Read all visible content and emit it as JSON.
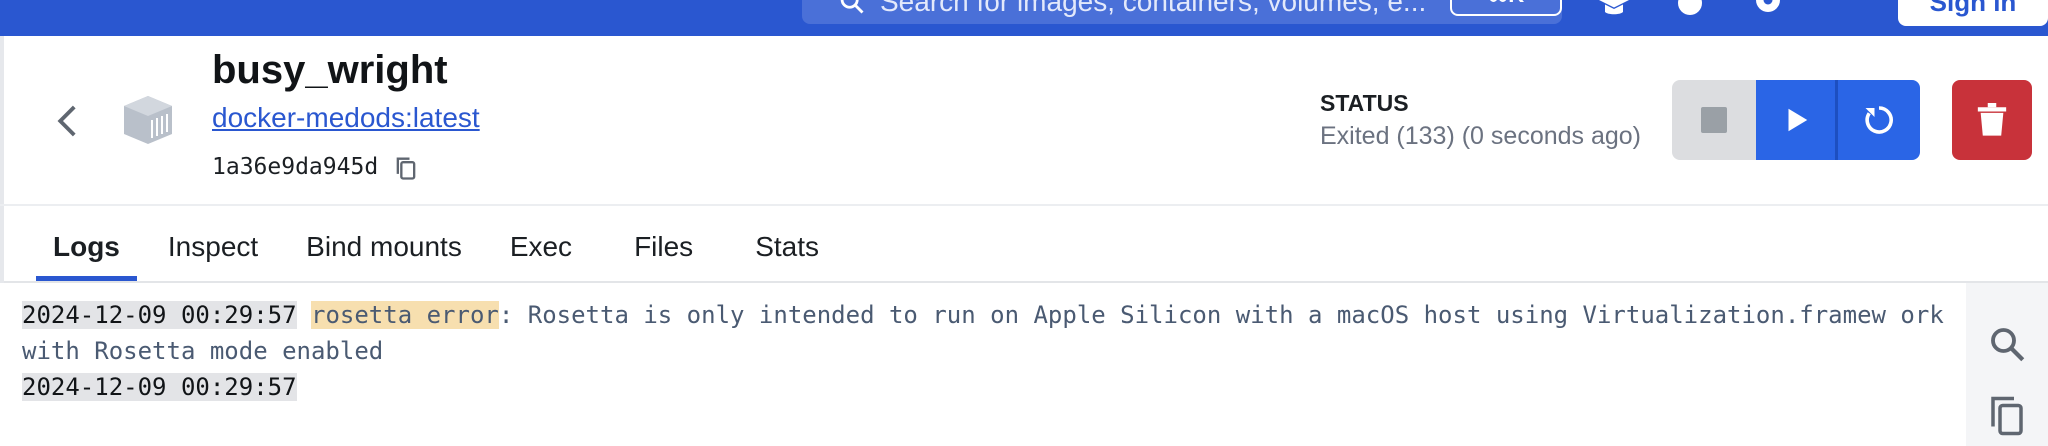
{
  "topbar": {
    "search_placeholder": "Search for images, containers, volumes, e...",
    "search_shortcut": "⌘K",
    "signin_label": "Sign in",
    "icons": [
      "learning-center-icon",
      "extensions-icon",
      "settings-icon",
      "apps-grid-icon"
    ]
  },
  "container": {
    "name": "busy_wright",
    "image": "docker-medods:latest",
    "id": "1a36e9da945d",
    "status_label": "STATUS",
    "status_text": "Exited (133) (0 seconds ago)"
  },
  "tabs": [
    {
      "label": "Logs",
      "active": true
    },
    {
      "label": "Inspect",
      "active": false
    },
    {
      "label": "Bind mounts",
      "active": false
    },
    {
      "label": "Exec",
      "active": false
    },
    {
      "label": "Files",
      "active": false
    },
    {
      "label": "Stats",
      "active": false
    }
  ],
  "logs": {
    "lines": [
      {
        "timestamp": "2024-12-09 00:29:57",
        "highlight": "rosetta error",
        "message": ": Rosetta is only intended to run on Apple Silicon with a macOS host using Virtualization.framew ork with Rosetta mode enabled"
      },
      {
        "timestamp": "2024-12-09 00:29:57",
        "highlight": "",
        "message": ""
      }
    ]
  },
  "colors": {
    "brand_blue": "#2a57d0",
    "action_blue": "#2a65e6",
    "danger_red": "#c8323a",
    "highlight": "#f7dfaf"
  }
}
